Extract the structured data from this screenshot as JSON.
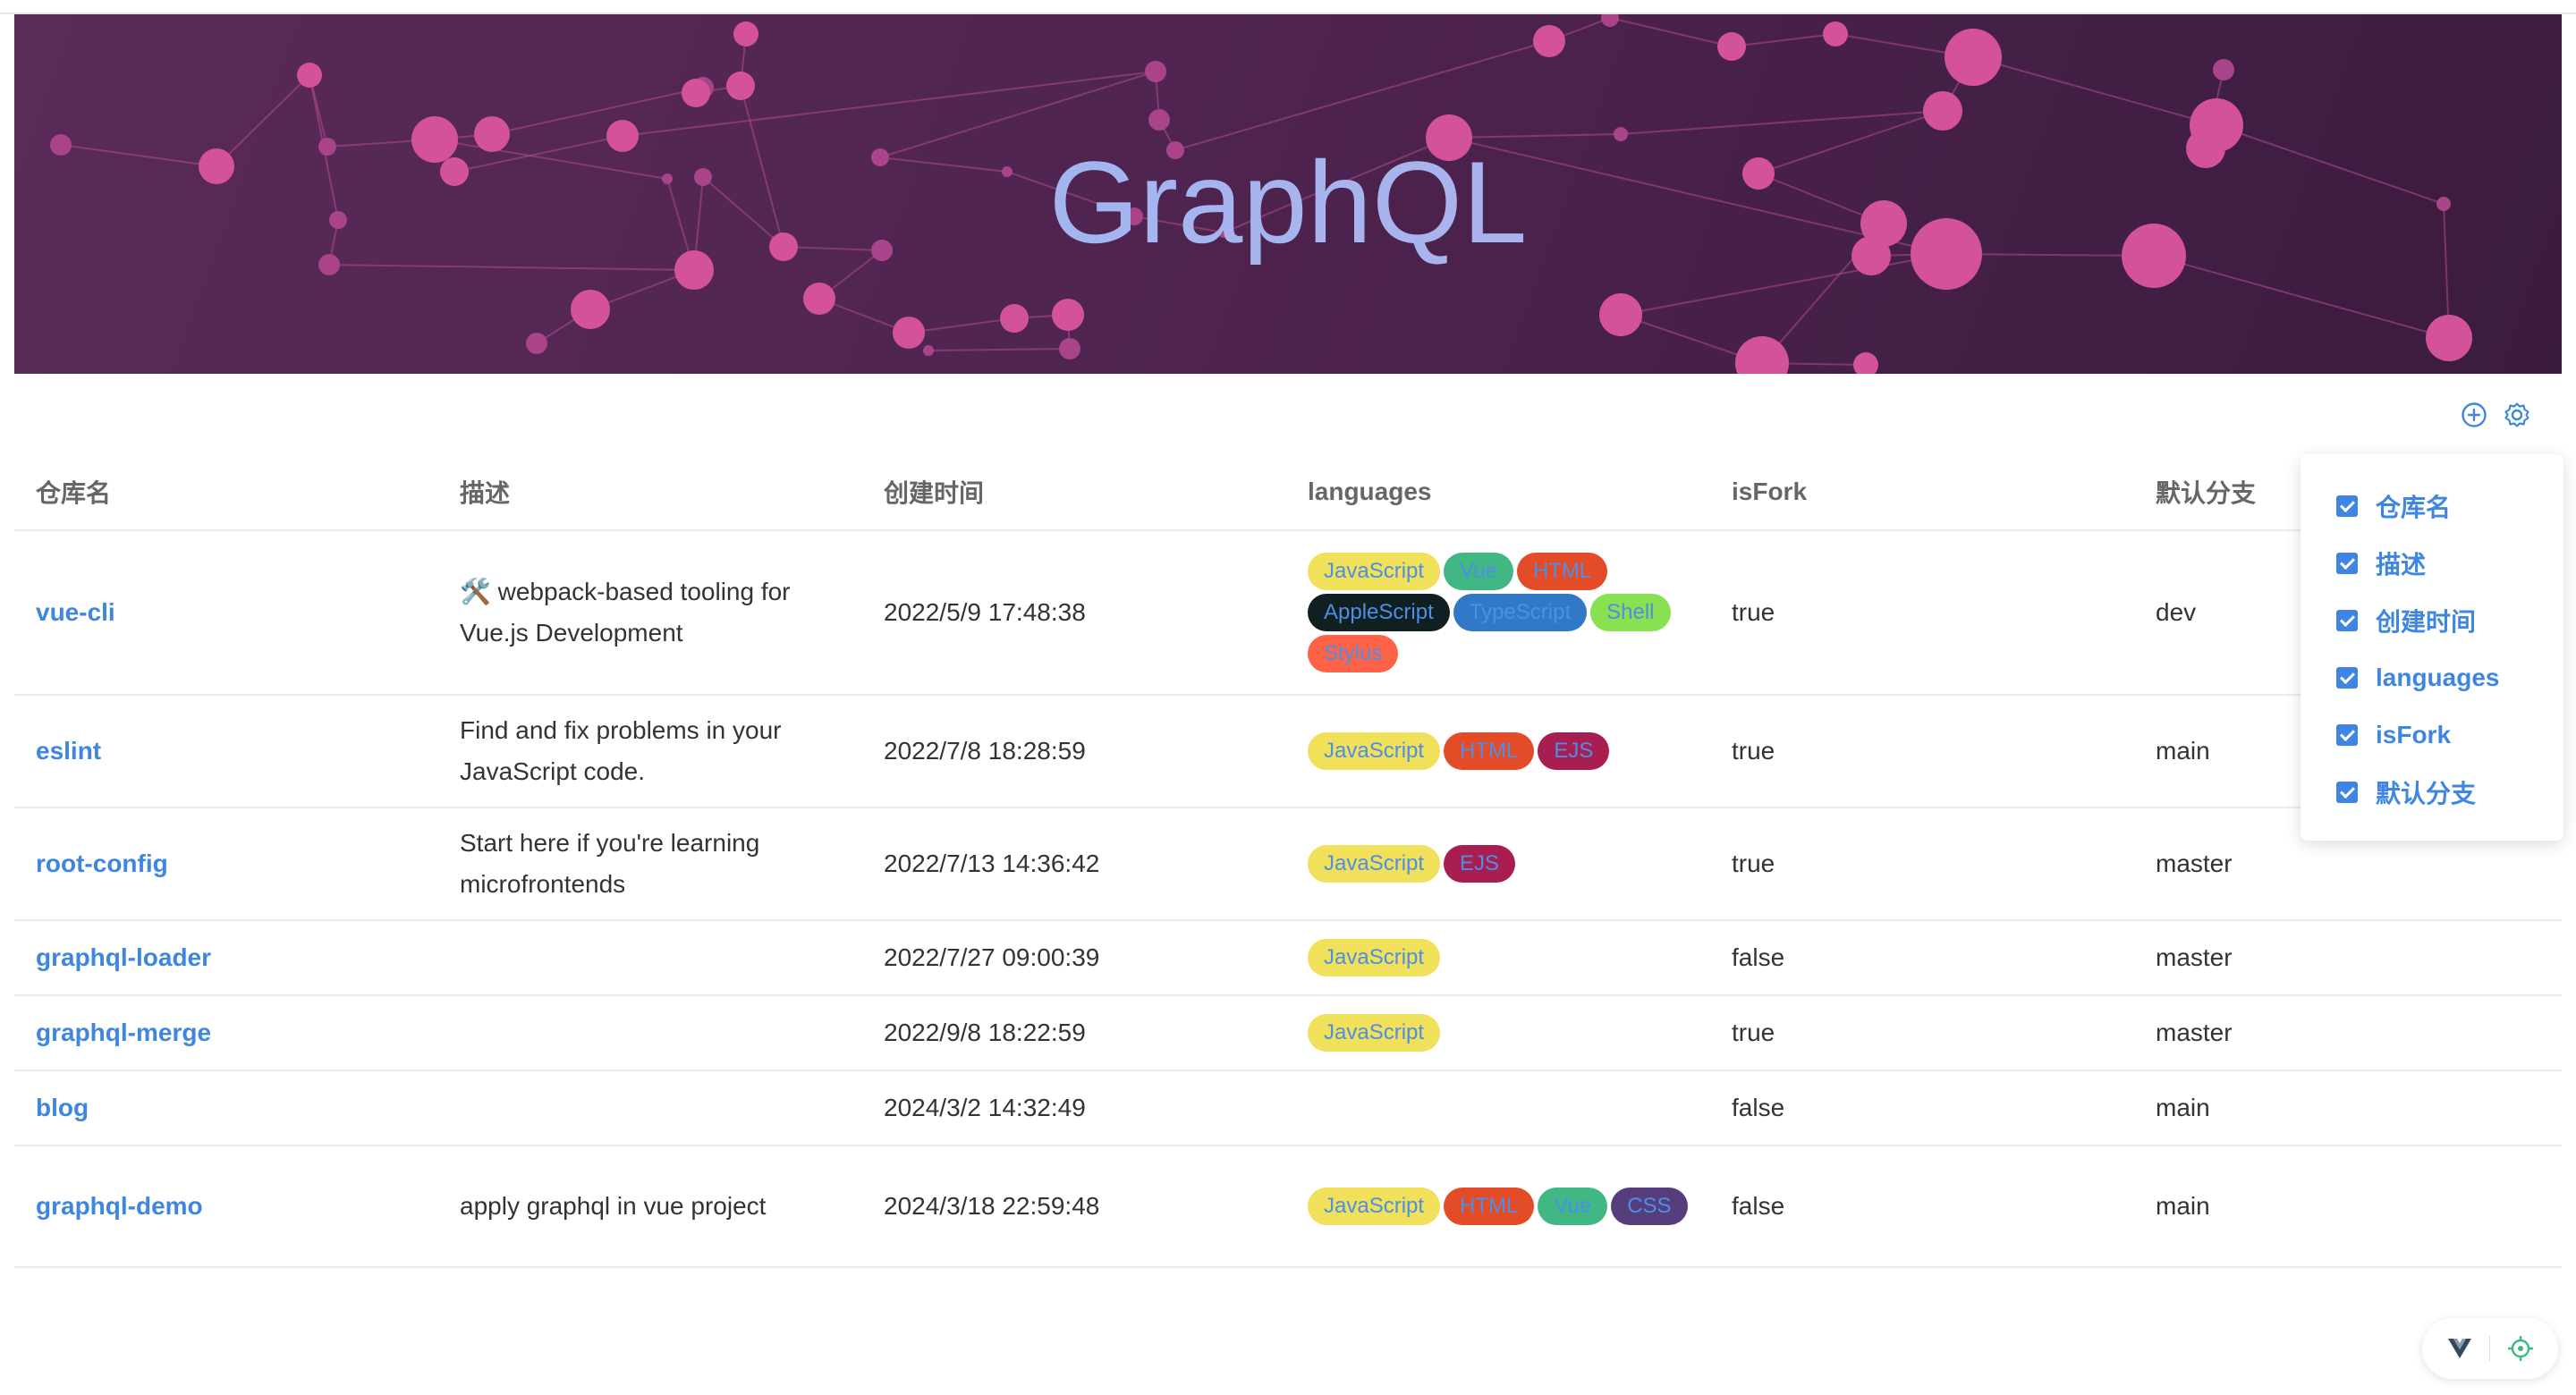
{
  "banner": {
    "title": "GraphQL"
  },
  "toolbar": {
    "add_icon": "plus-circle-icon",
    "settings_icon": "gear-icon"
  },
  "table": {
    "headers": {
      "name": "仓库名",
      "description": "描述",
      "created": "创建时间",
      "languages": "languages",
      "isFork": "isFork",
      "branch": "默认分支"
    },
    "rows": [
      {
        "name": "vue-cli",
        "description": "🛠️ webpack-based tooling for Vue.js Development",
        "created": "2022/5/9 17:48:38",
        "languages": [
          {
            "name": "JavaScript",
            "color": "#f1e05a"
          },
          {
            "name": "Vue",
            "color": "#41b883"
          },
          {
            "name": "HTML",
            "color": "#e34c26"
          },
          {
            "name": "AppleScript",
            "color": "#101f1f"
          },
          {
            "name": "TypeScript",
            "color": "#3178c6"
          },
          {
            "name": "Shell",
            "color": "#89e051"
          },
          {
            "name": "Stylus",
            "color": "#ff6347"
          }
        ],
        "isFork": "true",
        "branch": "dev"
      },
      {
        "name": "eslint",
        "description": "Find and fix problems in your JavaScript code.",
        "created": "2022/7/8 18:28:59",
        "languages": [
          {
            "name": "JavaScript",
            "color": "#f1e05a"
          },
          {
            "name": "HTML",
            "color": "#e34c26"
          },
          {
            "name": "EJS",
            "color": "#a91e50"
          }
        ],
        "isFork": "true",
        "branch": "main"
      },
      {
        "name": "root-config",
        "description": "Start here if you're learning microfrontends",
        "created": "2022/7/13 14:36:42",
        "languages": [
          {
            "name": "JavaScript",
            "color": "#f1e05a"
          },
          {
            "name": "EJS",
            "color": "#a91e50"
          }
        ],
        "isFork": "true",
        "branch": "master"
      },
      {
        "name": "graphql-loader",
        "description": "",
        "created": "2022/7/27 09:00:39",
        "languages": [
          {
            "name": "JavaScript",
            "color": "#f1e05a"
          }
        ],
        "isFork": "false",
        "branch": "master"
      },
      {
        "name": "graphql-merge",
        "description": "",
        "created": "2022/9/8 18:22:59",
        "languages": [
          {
            "name": "JavaScript",
            "color": "#f1e05a"
          }
        ],
        "isFork": "true",
        "branch": "master"
      },
      {
        "name": "blog",
        "description": "",
        "created": "2024/3/2 14:32:49",
        "languages": [],
        "isFork": "false",
        "branch": "main"
      },
      {
        "name": "graphql-demo",
        "description": "apply graphql in vue project",
        "created": "2024/3/18 22:59:48",
        "languages": [
          {
            "name": "JavaScript",
            "color": "#f1e05a"
          },
          {
            "name": "HTML",
            "color": "#e34c26"
          },
          {
            "name": "Vue",
            "color": "#41b883"
          },
          {
            "name": "CSS",
            "color": "#563d7c"
          }
        ],
        "isFork": "false",
        "branch": "main"
      }
    ]
  },
  "column_settings": {
    "items": [
      {
        "label": "仓库名",
        "checked": true
      },
      {
        "label": "描述",
        "checked": true
      },
      {
        "label": "创建时间",
        "checked": true
      },
      {
        "label": "languages",
        "checked": true
      },
      {
        "label": "isFork",
        "checked": true
      },
      {
        "label": "默认分支",
        "checked": true
      }
    ]
  },
  "devtools": {
    "vue_icon": "vue-logo-icon",
    "inspect_icon": "crosshair-icon"
  },
  "colors": {
    "accent": "#3f86e0",
    "banner_bg": "#4f2450",
    "node": "#d4529a"
  }
}
